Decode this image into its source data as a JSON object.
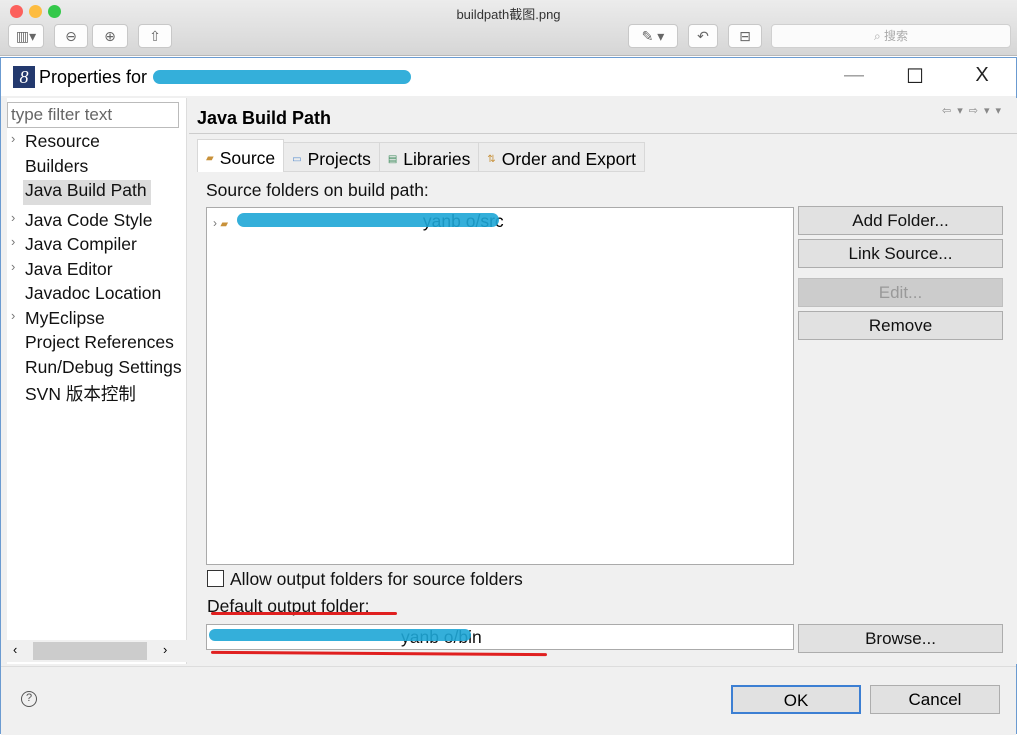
{
  "mac": {
    "title": "buildpath截图.png",
    "search_placeholder": "搜索"
  },
  "window": {
    "title": "Properties for",
    "controls": {
      "minimize": "—",
      "maximize": "☐",
      "close": "X"
    }
  },
  "filter": {
    "placeholder": "type filter text"
  },
  "tree": [
    {
      "label": "Resource",
      "expandable": true
    },
    {
      "label": "Builders",
      "expandable": false
    },
    {
      "label": "Java Build Path",
      "expandable": false,
      "selected": true
    },
    {
      "label": "Java Code Style",
      "expandable": true
    },
    {
      "label": "Java Compiler",
      "expandable": true
    },
    {
      "label": "Java Editor",
      "expandable": true
    },
    {
      "label": "Javadoc Location",
      "expandable": false
    },
    {
      "label": "MyEclipse",
      "expandable": true
    },
    {
      "label": "Project References",
      "expandable": false
    },
    {
      "label": "Run/Debug Settings",
      "expandable": false
    },
    {
      "label": "SVN 版本控制",
      "expandable": false
    }
  ],
  "page": {
    "title": "Java Build Path",
    "tabs": [
      {
        "label": "Source",
        "active": true
      },
      {
        "label": "Projects"
      },
      {
        "label": "Libraries"
      },
      {
        "label": "Order and Export"
      }
    ],
    "source_label": "Source folders on build path:",
    "source_entry_suffix": "yanb  o/src",
    "buttons": {
      "add_folder": "Add Folder...",
      "link_source": "Link Source...",
      "edit": "Edit...",
      "remove": "Remove",
      "browse": "Browse..."
    },
    "allow_output_label": "Allow output folders for source folders",
    "allow_output_checked": false,
    "default_output_label": "Default output folder:",
    "default_output_suffix": "yanb  o/bin"
  },
  "footer": {
    "help": "?",
    "ok": "OK",
    "cancel": "Cancel"
  },
  "colors": {
    "redaction": "#1ea6d6",
    "underline": "#e02020",
    "default_button_border": "#3c7fd3"
  }
}
